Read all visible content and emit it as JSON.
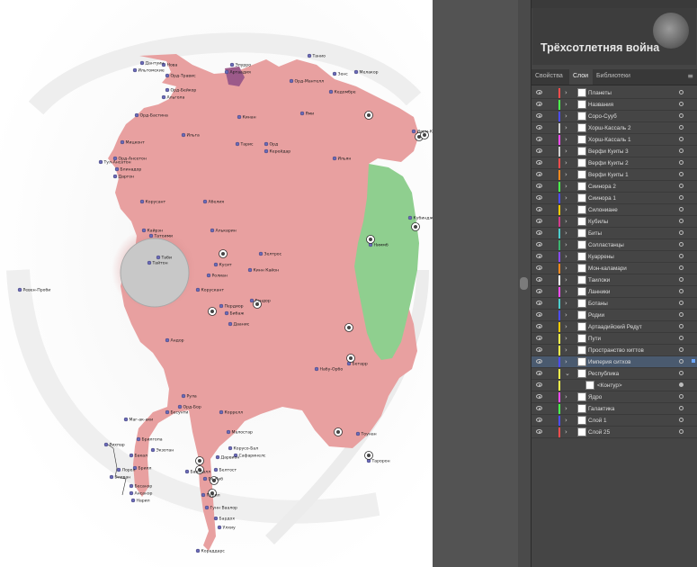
{
  "document": {
    "title": "Трёхсотлетняя война",
    "thumbnail_icon": "document-thumbnail-icon"
  },
  "tabs": [
    {
      "label": "Свойства",
      "active": false
    },
    {
      "label": "Слои",
      "active": true
    },
    {
      "label": "Библиотеки",
      "active": false
    }
  ],
  "tab_menu_icon": "panel-menu-icon",
  "layers": [
    {
      "name": "Планеты",
      "color": "#ff4d4d",
      "expanded": false,
      "selected": false
    },
    {
      "name": "Названия",
      "color": "#4dff4d",
      "expanded": false,
      "selected": false
    },
    {
      "name": "Соро-Сууб",
      "color": "#4d4dff",
      "expanded": false,
      "selected": false
    },
    {
      "name": "Хорш-Кассаль 2",
      "color": "#d0d0d0",
      "expanded": false,
      "selected": false
    },
    {
      "name": "Хорш-Кассаль 1",
      "color": "#ff4dff",
      "expanded": false,
      "selected": false
    },
    {
      "name": "Верфи Куиты 3",
      "color": "#d0d0d0",
      "expanded": false,
      "selected": false
    },
    {
      "name": "Верфи Куиты 2",
      "color": "#ff4d4d",
      "expanded": false,
      "selected": false
    },
    {
      "name": "Верфи Куиты 1",
      "color": "#ff8a1f",
      "expanded": false,
      "selected": false
    },
    {
      "name": "Сиинора 2",
      "color": "#4dff4d",
      "expanded": false,
      "selected": false
    },
    {
      "name": "Сиинора 1",
      "color": "#4d4dff",
      "expanded": false,
      "selected": false
    },
    {
      "name": "Силониане",
      "color": "#ffcc00",
      "expanded": false,
      "selected": false
    },
    {
      "name": "Кубилы",
      "color": "#d23c8c",
      "expanded": false,
      "selected": false
    },
    {
      "name": "Биты",
      "color": "#4dcfcf",
      "expanded": false,
      "selected": false
    },
    {
      "name": "Солластанцы",
      "color": "#3cb371",
      "expanded": false,
      "selected": false
    },
    {
      "name": "Куаррены",
      "color": "#8a4dff",
      "expanded": false,
      "selected": false
    },
    {
      "name": "Мон-каламари",
      "color": "#ff8a1f",
      "expanded": false,
      "selected": false
    },
    {
      "name": "Таилоки",
      "color": "#ffffff",
      "expanded": false,
      "selected": false
    },
    {
      "name": "Ланники",
      "color": "#ff4dff",
      "expanded": false,
      "selected": false
    },
    {
      "name": "Ботаны",
      "color": "#4dcfcf",
      "expanded": false,
      "selected": false
    },
    {
      "name": "Родии",
      "color": "#4d4dff",
      "expanded": false,
      "selected": false
    },
    {
      "name": "Артаадийский Редут",
      "color": "#ffcc00",
      "expanded": false,
      "selected": false
    },
    {
      "name": "Пути",
      "color": "#ffff4d",
      "expanded": false,
      "selected": false
    },
    {
      "name": "Пространство хиттов",
      "color": "#ffff4d",
      "expanded": false,
      "selected": false
    },
    {
      "name": "Империя ситхов",
      "color": "#4d4dff",
      "expanded": false,
      "selected": true
    },
    {
      "name": "Республика",
      "color": "#ffff4d",
      "expanded": true,
      "selected": false
    },
    {
      "name": "<Контур>",
      "color": "#ffff4d",
      "expanded": false,
      "selected": false,
      "sublayer": true
    },
    {
      "name": "Ядро",
      "color": "#ff4dff",
      "expanded": false,
      "selected": false
    },
    {
      "name": "Галактика",
      "color": "#4dff4d",
      "expanded": false,
      "selected": false
    },
    {
      "name": "Слой 1",
      "color": "#4d4dff",
      "expanded": false,
      "selected": false
    },
    {
      "name": "Слой 25",
      "color": "#ff4d4d",
      "expanded": false,
      "selected": false
    }
  ],
  "map": {
    "colors": {
      "republic": "#e8a0a0",
      "sith": "#8fcf8f",
      "planet": "#6b6bb8",
      "hole": "#c8c8c8",
      "artaad": "#9c5a8a"
    },
    "labels": [
      {
        "text": "Дантуин"
      },
      {
        "text": "Нова"
      },
      {
        "text": "Ильтомские"
      },
      {
        "text": "Орд-Травис"
      },
      {
        "text": "Орд-Бейкор"
      },
      {
        "text": "Альгола"
      },
      {
        "text": "Орд-Бастина"
      },
      {
        "text": "Мицконт"
      },
      {
        "text": "Орд-Ансетон"
      },
      {
        "text": "Тул-Ансатон"
      },
      {
        "text": "Блинадор"
      },
      {
        "text": "Даргон"
      },
      {
        "text": "Татоими"
      },
      {
        "text": "Артаадия"
      },
      {
        "text": "Элурро"
      },
      {
        "text": "Кинан"
      },
      {
        "text": "Танио"
      },
      {
        "text": "Зенс"
      },
      {
        "text": "Мелакор"
      },
      {
        "text": "Кедомбре"
      },
      {
        "text": "Орд-Мантелл"
      },
      {
        "text": "Ями"
      },
      {
        "text": "Тарис"
      },
      {
        "text": "Орд"
      },
      {
        "text": "Керейдар"
      },
      {
        "text": "Ильян"
      },
      {
        "text": "Ильга"
      },
      {
        "text": "Абелия"
      },
      {
        "text": "Ильм-Кран"
      },
      {
        "text": "Корусант"
      },
      {
        "text": "Кубиндж"
      },
      {
        "text": "Кайрэн"
      },
      {
        "text": "Алькарин"
      },
      {
        "text": "Зелтрос"
      },
      {
        "text": "Кусит"
      },
      {
        "text": "Кинн Кайон"
      },
      {
        "text": "Ролиан"
      },
      {
        "text": "Корускант"
      },
      {
        "text": "Пердиор"
      },
      {
        "text": "Бибаж"
      },
      {
        "text": "Гэндор"
      },
      {
        "text": "Даанис"
      },
      {
        "text": "Таби"
      },
      {
        "text": "Тайтон"
      },
      {
        "text": "Ревен-Проби"
      },
      {
        "text": "Андор"
      },
      {
        "text": "Ниммб"
      },
      {
        "text": "Набу-Орбо"
      },
      {
        "text": "Бетарр"
      },
      {
        "text": "Рула"
      },
      {
        "text": "Орд-Бор"
      },
      {
        "text": "Коррелл"
      },
      {
        "text": "Бесунти"
      },
      {
        "text": "Маг-ак-аки"
      },
      {
        "text": "Малостар"
      },
      {
        "text": "Корусо-Бал"
      },
      {
        "text": "Сафаринелс"
      },
      {
        "text": "Брилгопа"
      },
      {
        "text": "Дарвион"
      },
      {
        "text": "Белтост"
      },
      {
        "text": "Тоунан"
      },
      {
        "text": "Бакал"
      },
      {
        "text": "Брилл"
      },
      {
        "text": "Экзотан"
      },
      {
        "text": "Бесанэр"
      },
      {
        "text": "Ансанэр"
      },
      {
        "text": "Нарил"
      },
      {
        "text": "Лорол"
      },
      {
        "text": "Эливан"
      },
      {
        "text": "Рихпар"
      },
      {
        "text": "Бардох"
      },
      {
        "text": "Улхиу"
      },
      {
        "text": "Кораддарс"
      },
      {
        "text": "Гунн Ваалор"
      },
      {
        "text": "Пурил"
      },
      {
        "text": "Бал-Калл"
      },
      {
        "text": "Ба-Каб"
      },
      {
        "text": "Таророн"
      }
    ]
  }
}
